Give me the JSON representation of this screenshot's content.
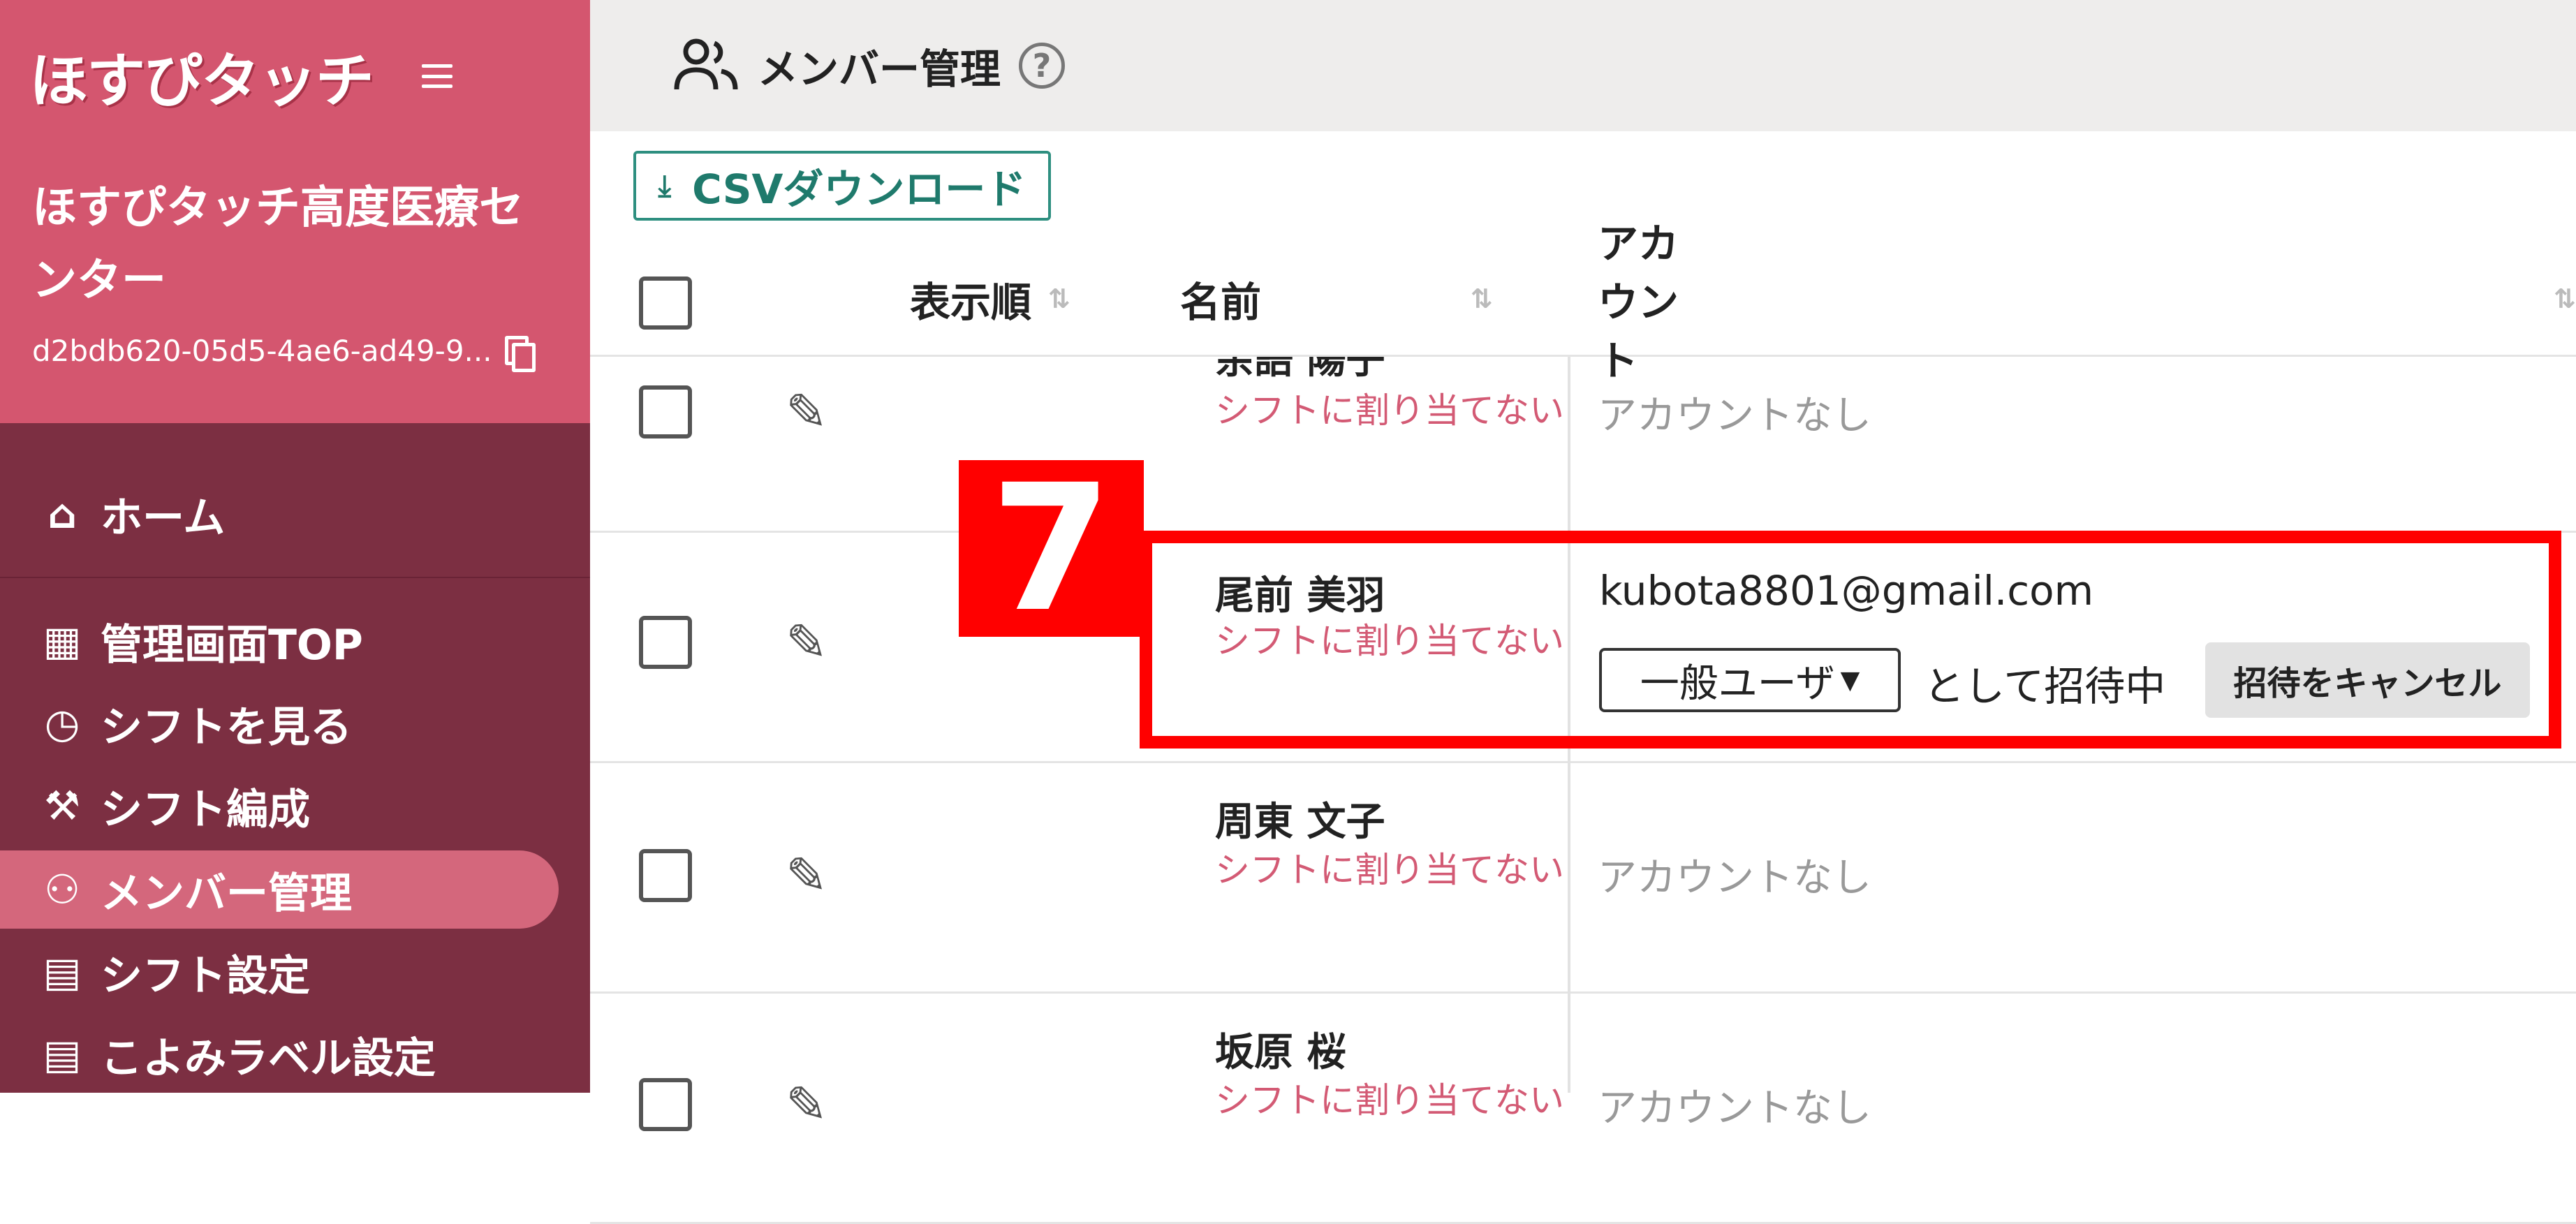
{
  "app": {
    "logo_text": "ほすぴタッチ",
    "org_name": "ほすぴタッチ高度医療センター",
    "org_id": "d2bdb620-05d5-4ae6-ad49-9..."
  },
  "nav": {
    "items": [
      {
        "label": "ホーム",
        "icon": "home-icon",
        "glyph": "⌂"
      },
      {
        "label": "管理画面TOP",
        "icon": "dashboard-icon",
        "glyph": "▦"
      },
      {
        "label": "シフトを見る",
        "icon": "clock-icon",
        "glyph": "◷"
      },
      {
        "label": "シフト編成",
        "icon": "wrench-icon",
        "glyph": "⚒"
      },
      {
        "label": "メンバー管理",
        "icon": "members-icon",
        "glyph": "⚇",
        "active": true
      },
      {
        "label": "シフト設定",
        "icon": "calendar-icon",
        "glyph": "▤"
      },
      {
        "label": "こよみラベル設定",
        "icon": "calendar-label-icon",
        "glyph": "▤"
      }
    ]
  },
  "header": {
    "title": "メンバー管理",
    "help_glyph": "?"
  },
  "toolbar": {
    "csv_label": "CSVダウンロード",
    "download_glyph": "⤓"
  },
  "table": {
    "columns": {
      "order": "表示順",
      "name": "名前",
      "account": "アカウント",
      "sort_glyph": "⇅"
    },
    "rows": [
      {
        "name": "余語 陽子",
        "note": "シフトに割り当てない",
        "account": "アカウントなし"
      },
      {
        "name": "尾前 美羽",
        "note": "シフトに割り当てない",
        "email": "kubota8801@gmail.com",
        "role": "一般ユーザ",
        "invite_status": "として招待中",
        "cancel_label": "招待をキャンセル"
      },
      {
        "name": "周東 文子",
        "note": "シフトに割り当てない",
        "account": "アカウントなし"
      },
      {
        "name": "坂原 桜",
        "note": "シフトに割り当てない",
        "account": "アカウントなし"
      }
    ]
  },
  "annotation": {
    "step_number": "7",
    "color": "#ff0000"
  },
  "colors": {
    "sidebar_top": "#d4566f",
    "sidebar_bottom": "#7c2f42",
    "accent_teal": "#1f7a6c",
    "note_pink": "#d35a74"
  }
}
